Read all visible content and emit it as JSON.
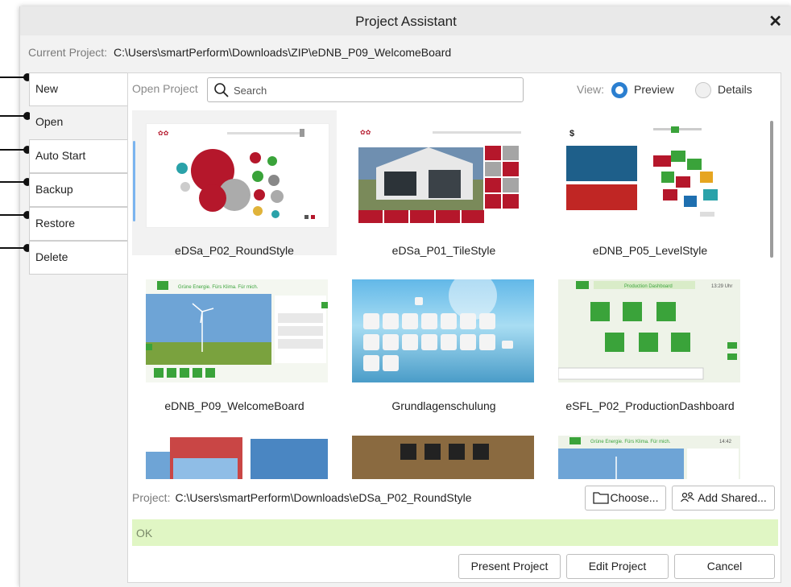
{
  "window": {
    "title": "Project Assistant",
    "close_label": "✕"
  },
  "current_project": {
    "label": "Current Project:",
    "path": "C:\\Users\\smartPerform\\Downloads\\ZIP\\eDNB_P09_WelcomeBoard"
  },
  "sidebar": {
    "tabs": [
      "New",
      "Open",
      "Auto Start",
      "Backup",
      "Restore",
      "Delete"
    ]
  },
  "open_panel": {
    "label": "Open Project",
    "search_placeholder": "Search",
    "view_label": "View:",
    "view_options": [
      "Preview",
      "Details"
    ],
    "view_selected": "Preview"
  },
  "projects": [
    {
      "name": "eDSa_P02_RoundStyle",
      "selected": true
    },
    {
      "name": "eDSa_P01_TileStyle"
    },
    {
      "name": "eDNB_P05_LevelStyle"
    },
    {
      "name": "eDNB_P09_WelcomeBoard",
      "thumb_text": "Grüne Energie. Fürs Klima. Für mich."
    },
    {
      "name": "Grundlagenschulung"
    },
    {
      "name": "eSFL_P02_ProductionDashboard",
      "thumb_text": "Production Dashboard",
      "thumb_time": "13:29 Uhr"
    },
    {
      "name": ""
    },
    {
      "name": ""
    },
    {
      "name": "",
      "thumb_text": "Grüne Energie. Fürs Klima. Für mich.",
      "thumb_time": "14:42"
    }
  ],
  "project_line": {
    "label": "Project:",
    "path": "C:\\Users\\smartPerform\\Downloads\\eDSa_P02_RoundStyle"
  },
  "buttons": {
    "choose": "Choose...",
    "add_shared": "Add Shared...",
    "present": "Present Project",
    "edit": "Edit Project",
    "cancel": "Cancel"
  },
  "status": {
    "text": "OK"
  },
  "colors": {
    "accent": "#2b7fd0",
    "status_bg": "#e0f6c4",
    "thumb_red": "#b5172b",
    "thumb_green": "#3aa33a"
  }
}
